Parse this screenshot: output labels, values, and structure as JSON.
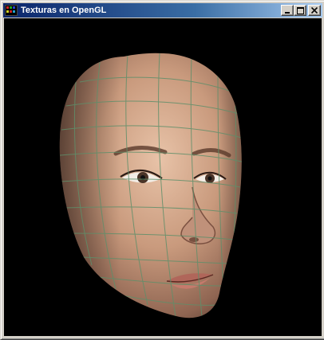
{
  "window": {
    "title": "Texturas en OpenGL",
    "controls": {
      "minimize_icon": "minimize-icon",
      "maximize_icon": "maximize-icon",
      "close_icon": "close-icon"
    }
  },
  "viewport": {
    "background": "#000000",
    "content": "textured-face-model",
    "wireframe_color": "#5f8f6a"
  },
  "colors": {
    "titlebar_start": "#0a246a",
    "titlebar_end": "#a6caf0",
    "chrome": "#d4d0c8"
  }
}
